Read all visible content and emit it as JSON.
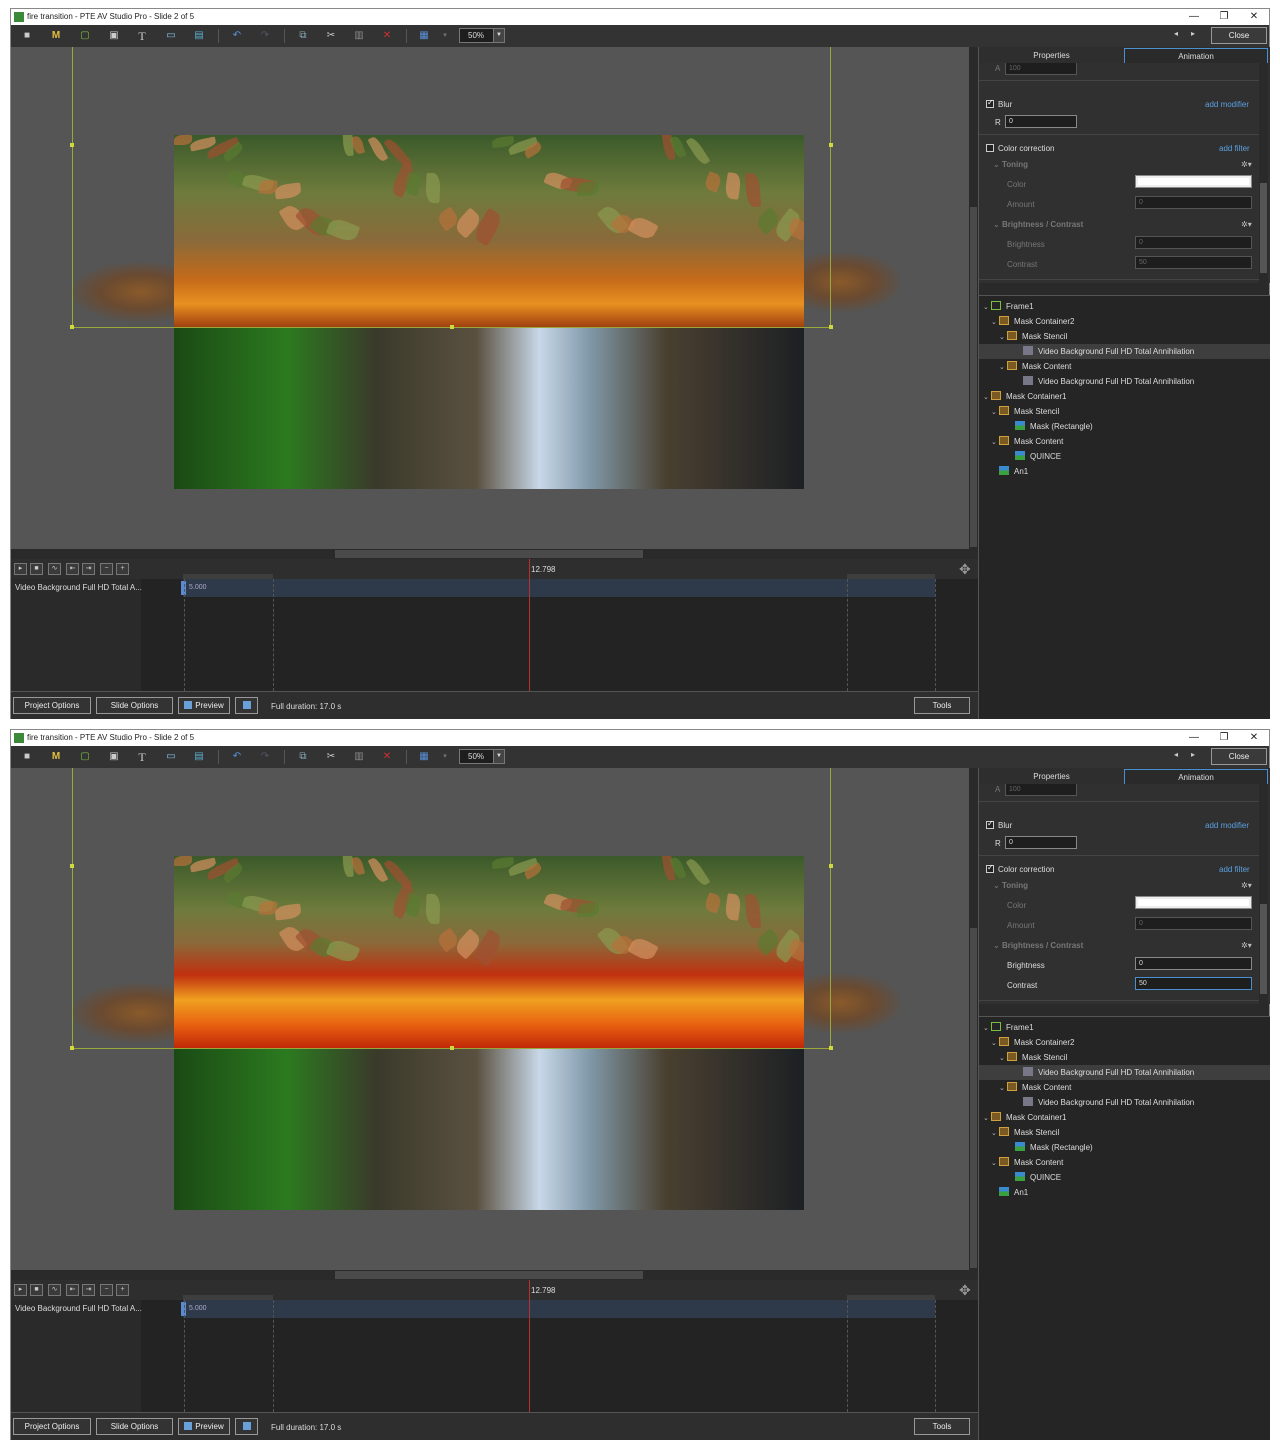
{
  "window": {
    "title": "fire transition - PTE AV Studio Pro - Slide 2 of 5",
    "minimize": "—",
    "restore": "❐",
    "close": "✕"
  },
  "toolbar": {
    "zoom_value": "50%",
    "close_label": "Close",
    "prev_arrow": "◂",
    "next_arrow": "▸",
    "icons": [
      "camera-icon",
      "mask-icon",
      "frame-icon",
      "video-icon",
      "text-icon",
      "image-icon",
      "picture-icon",
      "undo-icon",
      "redo-icon",
      "copy-icon",
      "cut-icon",
      "paste-icon",
      "delete-icon",
      "grid-icon"
    ]
  },
  "tabs": {
    "properties": "Properties",
    "animation": "Animation"
  },
  "panels": [
    {
      "a_label": "A",
      "a_value": "100",
      "blur_label": "Blur",
      "blur_checked": true,
      "add_modifier": "add modifier",
      "r_label": "R",
      "r_value": "0",
      "color_correction_label": "Color correction",
      "color_correction_checked": false,
      "add_filter": "add filter",
      "toning_label": "Toning",
      "color_label": "Color",
      "amount_label": "Amount",
      "amount_value": "0",
      "bc_label": "Brightness / Contrast",
      "brightness_label": "Brightness",
      "brightness_value": "0",
      "contrast_label": "Contrast",
      "contrast_value": "50"
    },
    {
      "a_label": "A",
      "a_value": "100",
      "blur_label": "Blur",
      "blur_checked": true,
      "add_modifier": "add modifier",
      "r_label": "R",
      "r_value": "0",
      "color_correction_label": "Color correction",
      "color_correction_checked": true,
      "add_filter": "add filter",
      "toning_label": "Toning",
      "color_label": "Color",
      "amount_label": "Amount",
      "amount_value": "0",
      "bc_label": "Brightness / Contrast",
      "brightness_label": "Brightness",
      "brightness_value": "0",
      "contrast_label": "Contrast",
      "contrast_value": "50"
    }
  ],
  "tree": [
    {
      "label": "Frame1",
      "icon": "frame"
    },
    {
      "label": "Mask Container2",
      "icon": "mask"
    },
    {
      "label": "Mask Stencil",
      "icon": "mask"
    },
    {
      "label": "Video Background Full HD Total Annihilation",
      "icon": "vid"
    },
    {
      "label": "Mask Content",
      "icon": "mask"
    },
    {
      "label": "Video Background Full HD Total Annihilation",
      "icon": "vid"
    },
    {
      "label": "Mask Container1",
      "icon": "mask"
    },
    {
      "label": "Mask Stencil",
      "icon": "mask"
    },
    {
      "label": "Mask (Rectangle)",
      "icon": "img"
    },
    {
      "label": "Mask Content",
      "icon": "mask"
    },
    {
      "label": "QUINCE",
      "icon": "img"
    },
    {
      "label": "An1",
      "icon": "img"
    }
  ],
  "timeline": {
    "time_marker": "12.798",
    "track_name": "Video Background Full HD Total A...",
    "track_start": "5.000",
    "controls": [
      "▸",
      "■",
      "∿",
      "⇤",
      "⇥",
      "−",
      "+"
    ]
  },
  "statusbar": {
    "project_options": "Project Options",
    "slide_options": "Slide Options",
    "preview": "Preview",
    "full_duration": "Full duration: 17.0 s",
    "tools": "Tools"
  },
  "colors": {
    "accent": "#4a90d0",
    "guide": "#9aa83a",
    "playhead": "#b83030"
  }
}
